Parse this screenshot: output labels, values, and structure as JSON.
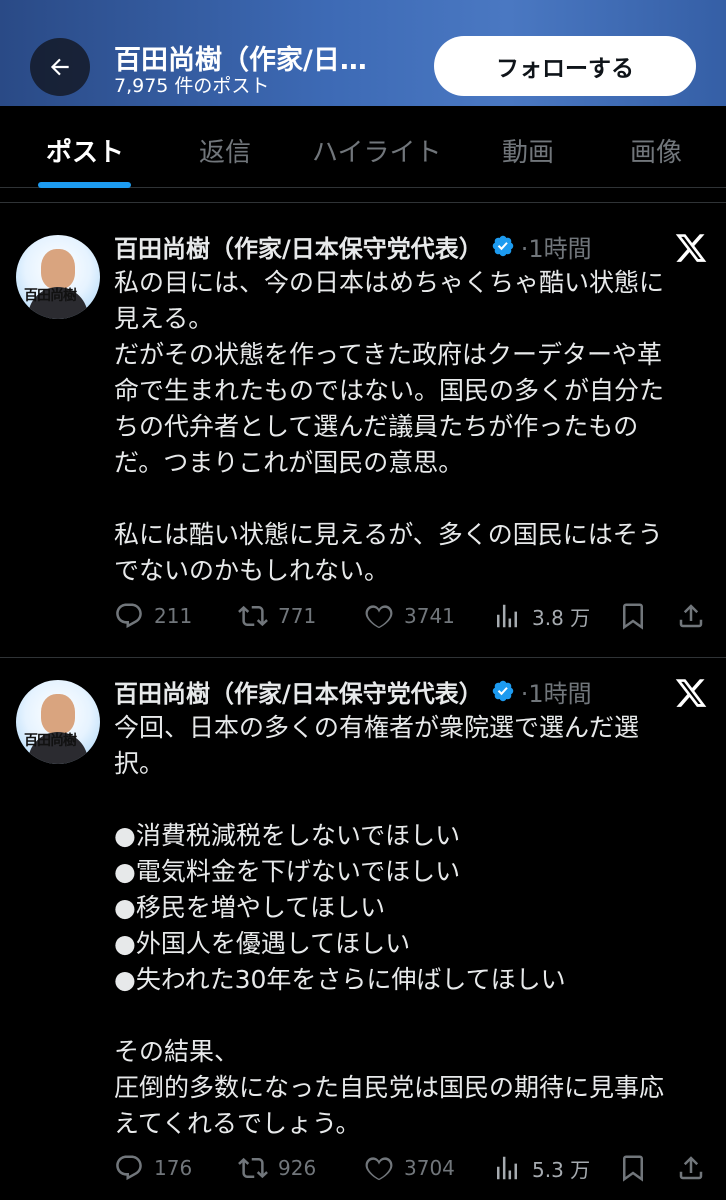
{
  "header": {
    "name": "百田尚樹（作家/日…",
    "post_count": "7,975 件のポスト",
    "follow_label": "フォローする"
  },
  "tabs": [
    "ポスト",
    "返信",
    "ハイライト",
    "動画",
    "画像"
  ],
  "posts": [
    {
      "author": "百田尚樹（作家/日本保守党代表）",
      "avatar_caption": "百田尚樹",
      "time": "·1時間",
      "text": "私の目には、今の日本はめちゃくちゃ酷い状態に\n見える。\nだがその状態を作ってきた政府はクーデターや革\n命で生まれたものではない。国民の多くが自分た\nちの代弁者として選んだ議員たちが作ったもの\nだ。つまりこれが国民の意思。\n\n私には酷い状態に見えるが、多くの国民にはそう\nでないのかもしれない。",
      "replies": "211",
      "reposts": "771",
      "likes": "3741",
      "views": "3.8 万"
    },
    {
      "author": "百田尚樹（作家/日本保守党代表）",
      "avatar_caption": "百田尚樹",
      "time": "·1時間",
      "text": "今回、日本の多くの有権者が衆院選で選んだ選\n択。\n\n●消費税減税をしないでほしい\n●電気料金を下げないでほしい\n●移民を増やしてほしい\n●外国人を優遇してほしい\n●失われた30年をさらに伸ばしてほしい\n\nその結果、\n圧倒的多数になった自民党は国民の期待に見事応\nえてくれるでしょう。",
      "replies": "176",
      "reposts": "926",
      "likes": "3704",
      "views": "5.3 万"
    }
  ],
  "colors": {
    "accent": "#1d9bf0",
    "background": "#000000",
    "text": "#e7e9ea",
    "muted": "#71767b"
  },
  "icons": [
    "back-arrow-icon",
    "verified-badge-icon",
    "x-logo-icon",
    "reply-icon",
    "repost-icon",
    "like-icon",
    "views-icon",
    "bookmark-icon",
    "share-icon"
  ]
}
